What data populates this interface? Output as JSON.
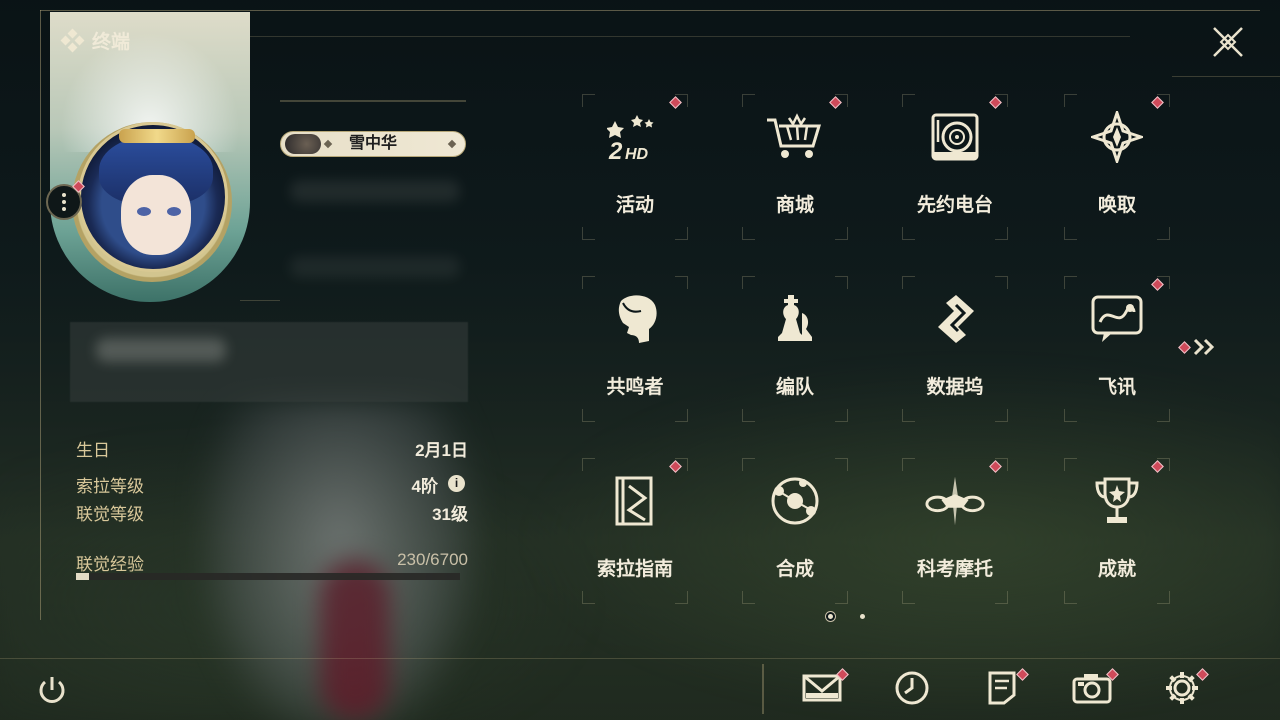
{
  "window": {
    "title": "终端"
  },
  "profile": {
    "player_name": "雪中华",
    "stats": [
      {
        "label": "生日",
        "value": "2月1日"
      },
      {
        "label": "索拉等级",
        "value": "4阶"
      },
      {
        "label": "联觉等级",
        "value": "31级"
      },
      {
        "label": "联觉经验",
        "value": "230/6700"
      }
    ],
    "exp_current": 230,
    "exp_max": 6700
  },
  "grid": {
    "items": [
      {
        "label": "活动",
        "icon": "events-2hd-icon",
        "notify": true
      },
      {
        "label": "商城",
        "icon": "shopping-cart-icon",
        "notify": true
      },
      {
        "label": "先约电台",
        "icon": "radio-record-icon",
        "notify": true
      },
      {
        "label": "唤取",
        "icon": "compass-star-icon",
        "notify": true
      },
      {
        "label": "共鸣者",
        "icon": "character-profile-icon",
        "notify": false
      },
      {
        "label": "编队",
        "icon": "chess-piece-icon",
        "notify": false
      },
      {
        "label": "数据坞",
        "icon": "data-dock-icon",
        "notify": false
      },
      {
        "label": "飞讯",
        "icon": "chat-bubble-icon",
        "notify": true
      },
      {
        "label": "索拉指南",
        "icon": "guide-book-icon",
        "notify": true
      },
      {
        "label": "合成",
        "icon": "synthesis-icon",
        "notify": false
      },
      {
        "label": "科考摩托",
        "icon": "motorcycle-icon",
        "notify": true
      },
      {
        "label": "成就",
        "icon": "trophy-icon",
        "notify": true
      }
    ],
    "pages": 2,
    "current_page": 1
  },
  "bottom_bar": {
    "items": [
      {
        "name": "mail",
        "icon": "mail-icon",
        "notify": true
      },
      {
        "name": "clock",
        "icon": "clock-icon",
        "notify": false
      },
      {
        "name": "notice",
        "icon": "notice-icon",
        "notify": true
      },
      {
        "name": "camera",
        "icon": "camera-icon",
        "notify": true
      },
      {
        "name": "settings",
        "icon": "gear-icon",
        "notify": true
      }
    ]
  },
  "colors": {
    "accent": "#e9e2cc",
    "label_gold": "#d9c89a",
    "notify_red": "#cf4a5a",
    "background": "#0d1719"
  }
}
